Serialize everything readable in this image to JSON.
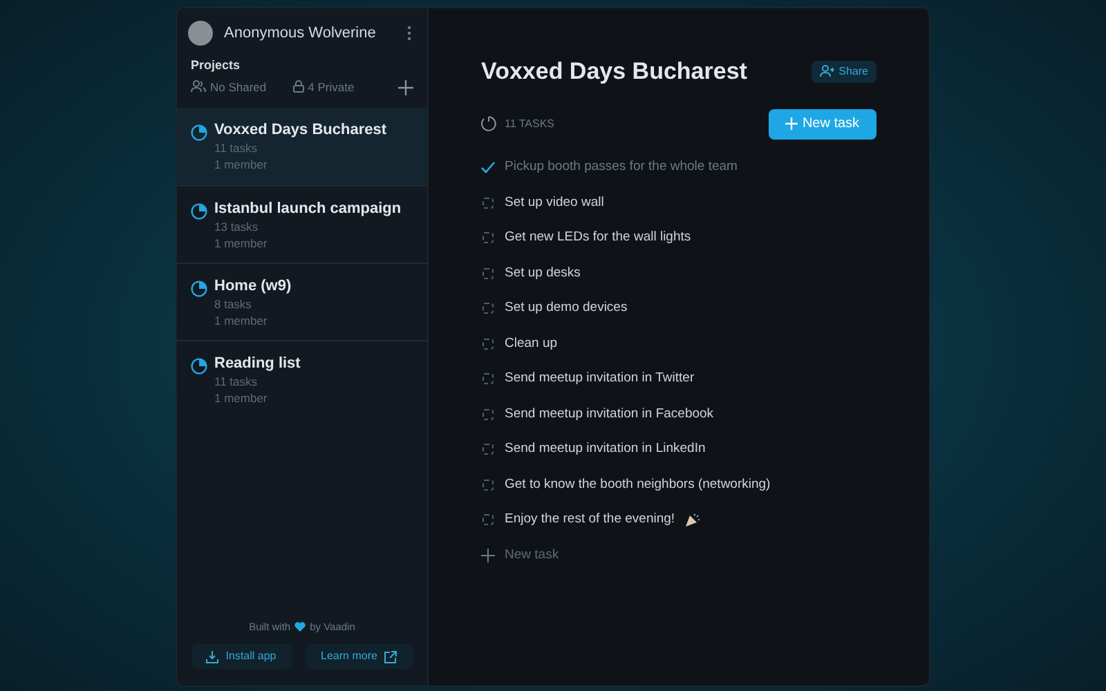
{
  "user": {
    "name": "Anonymous Wolverine"
  },
  "projects": {
    "heading": "Projects",
    "shared": "No Shared",
    "private": "4 Private",
    "items": [
      {
        "name": "Voxxed Days Bucharest",
        "tasks": "11 tasks",
        "members": "1 member",
        "selected": true
      },
      {
        "name": "Istanbul launch campaign",
        "tasks": "13 tasks",
        "members": "1 member",
        "selected": false
      },
      {
        "name": "Home (w9)",
        "tasks": "8 tasks",
        "members": "1 member",
        "selected": false
      },
      {
        "name": "Reading list",
        "tasks": "11 tasks",
        "members": "1 member",
        "selected": false
      }
    ]
  },
  "footer": {
    "built_before": "Built with",
    "built_after": "by Vaadin",
    "install": "Install app",
    "learn": "Learn more"
  },
  "main": {
    "title": "Voxxed Days Bucharest",
    "share": "Share",
    "count": "11 TASKS",
    "new_task_button": "New task",
    "tasks": [
      {
        "text": "Pickup booth passes for the whole team",
        "checked": true
      },
      {
        "text": "Set up video wall",
        "checked": false
      },
      {
        "text": "Get new LEDs for the wall lights",
        "checked": false
      },
      {
        "text": "Set up desks",
        "checked": false
      },
      {
        "text": "Set up demo devices",
        "checked": false
      },
      {
        "text": "Clean up",
        "checked": false
      },
      {
        "text": "Send meetup invitation in Twitter",
        "checked": false
      },
      {
        "text": "Send meetup invitation in Facebook",
        "checked": false
      },
      {
        "text": "Send meetup invitation in LinkedIn",
        "checked": false
      },
      {
        "text": "Get to know the booth neighbors (networking)",
        "checked": false
      },
      {
        "text": "Enjoy the rest of the evening!",
        "checked": false
      }
    ],
    "new_task_placeholder": "New task"
  }
}
